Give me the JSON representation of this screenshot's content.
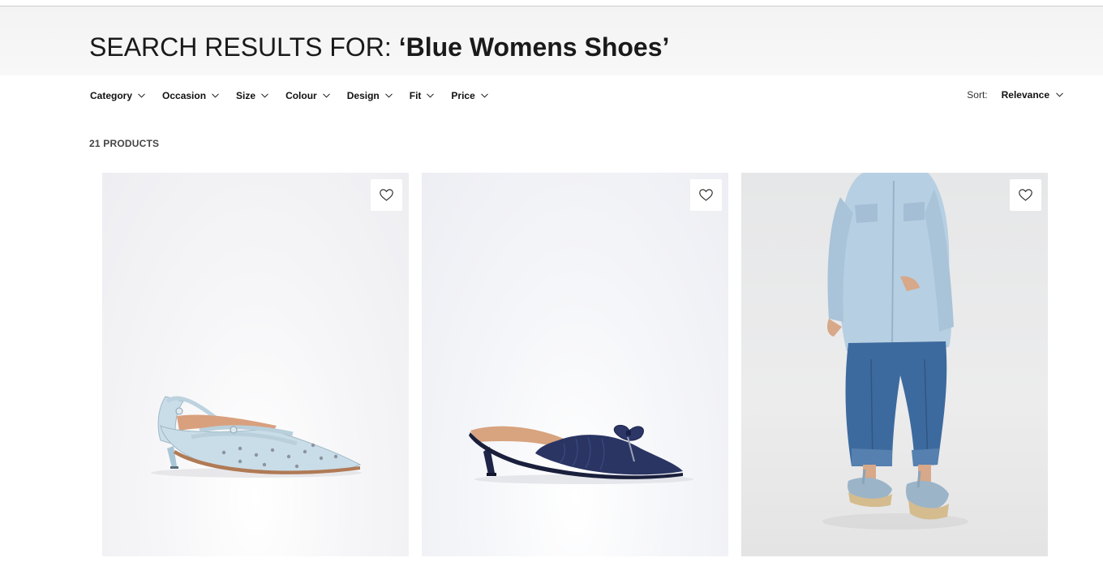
{
  "header": {
    "title_prefix": "SEARCH RESULTS FOR: ",
    "search_term": "‘Blue Womens Shoes’"
  },
  "filters": [
    {
      "label": "Category",
      "icon": "chevron-down-icon"
    },
    {
      "label": "Occasion",
      "icon": "chevron-down-icon"
    },
    {
      "label": "Size",
      "icon": "chevron-down-icon"
    },
    {
      "label": "Colour",
      "icon": "chevron-down-icon"
    },
    {
      "label": "Design",
      "icon": "chevron-down-icon"
    },
    {
      "label": "Fit",
      "icon": "chevron-down-icon"
    },
    {
      "label": "Price",
      "icon": "chevron-down-icon"
    }
  ],
  "sort": {
    "label": "Sort:",
    "value": "Relevance",
    "icon": "chevron-down-icon"
  },
  "results": {
    "count_label": "21 PRODUCTS"
  },
  "products": [
    {
      "image": "light denim studded slingback kitten heel",
      "wishlist_icon": "heart-icon"
    },
    {
      "image": "navy denim bow mule kitten heel",
      "wishlist_icon": "heart-icon"
    },
    {
      "image": "model in denim shirt and jeans with espadrille wedges",
      "wishlist_icon": "heart-icon"
    }
  ],
  "colors": {
    "hero_bg": "#f5f5f5",
    "text": "#111111",
    "light_denim": "#c9dde8",
    "dark_denim": "#2a3563",
    "mid_denim": "#3d5f8f"
  }
}
